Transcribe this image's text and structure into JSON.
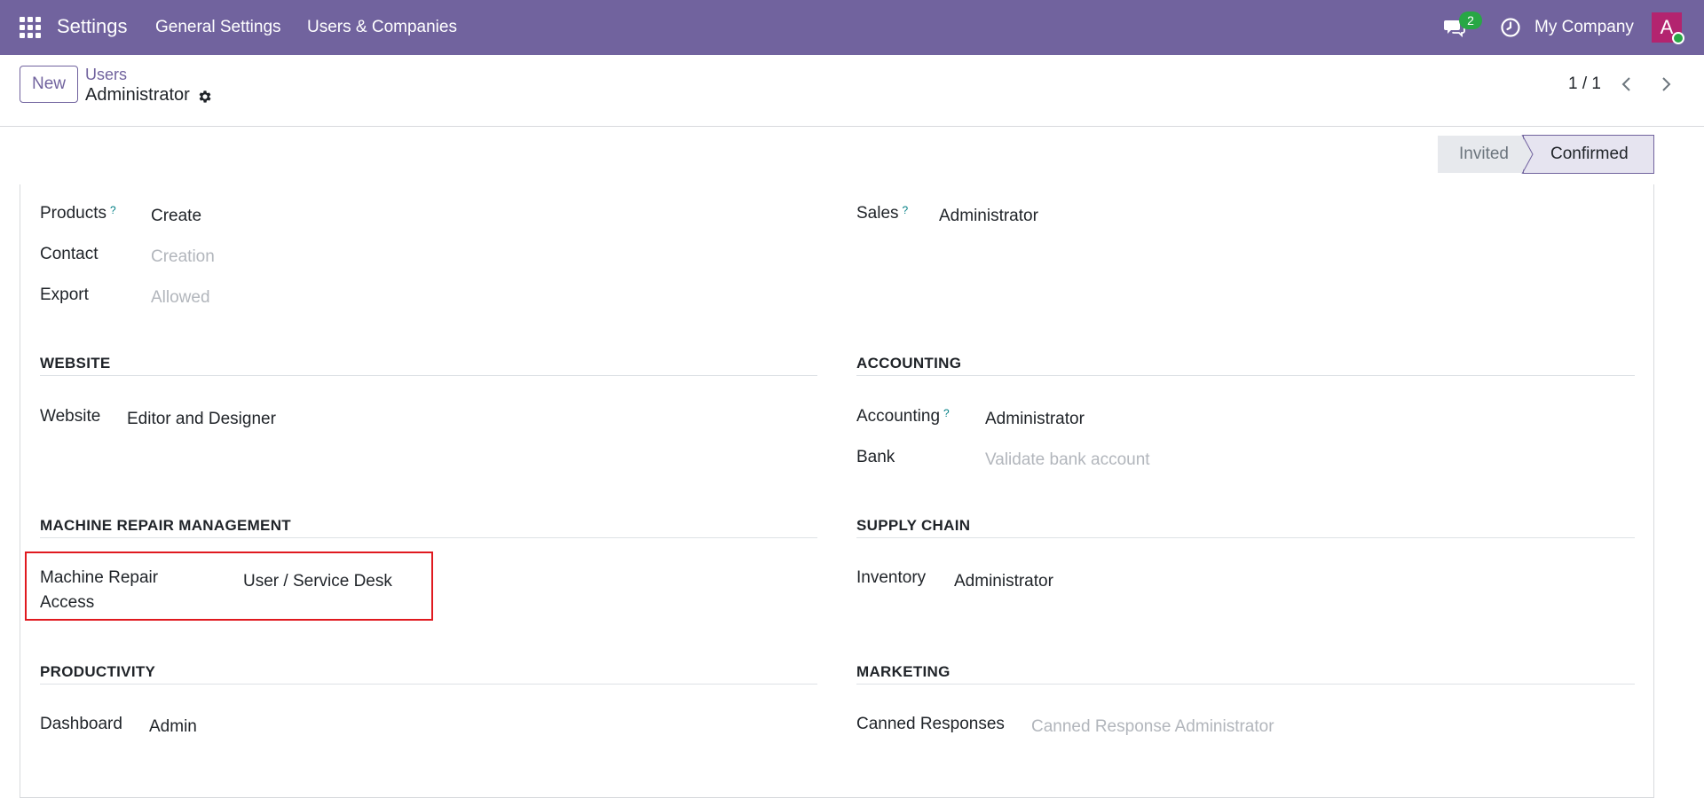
{
  "topbar": {
    "app_name": "Settings",
    "nav": [
      "General Settings",
      "Users & Companies"
    ],
    "chat_badge": "2",
    "company": "My Company",
    "avatar_letter": "A",
    "brand_color": "#71639e"
  },
  "control_panel": {
    "new_label": "New",
    "breadcrumb": "Users",
    "record_title": "Administrator",
    "pager": "1 / 1"
  },
  "status": {
    "invited": "Invited",
    "confirmed": "Confirmed",
    "current": "Confirmed"
  },
  "top_fields": {
    "products_label": "Products",
    "products_value": "Create",
    "contact_label": "Contact",
    "contact_value": "Creation",
    "export_label": "Export",
    "export_value": "Allowed",
    "sales_label": "Sales",
    "sales_value": "Administrator",
    "help_mark": "?"
  },
  "sections": {
    "website": {
      "title": "WEBSITE",
      "label": "Website",
      "value": "Editor and Designer"
    },
    "accounting": {
      "title": "ACCOUNTING",
      "accounting_label": "Accounting",
      "accounting_value": "Administrator",
      "bank_label": "Bank",
      "bank_value": "Validate bank account"
    },
    "machine_repair": {
      "title": "MACHINE REPAIR MANAGEMENT",
      "label_line1": "Machine Repair",
      "label_line2": "Access",
      "value": "User / Service Desk"
    },
    "supply_chain": {
      "title": "SUPPLY CHAIN",
      "label": "Inventory",
      "value": "Administrator"
    },
    "productivity": {
      "title": "PRODUCTIVITY",
      "label": "Dashboard",
      "value": "Admin"
    },
    "marketing": {
      "title": "MARKETING",
      "label": "Canned Responses",
      "value": "Canned Response Administrator"
    }
  }
}
